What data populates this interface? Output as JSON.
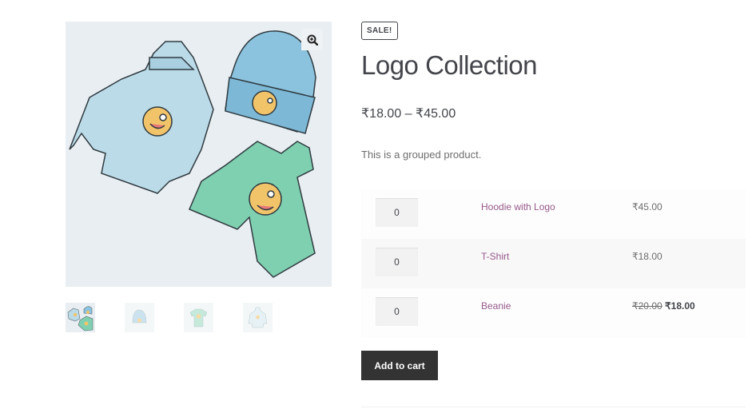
{
  "gallery": {
    "main_image_alt": "Hoodie, beanie and t-shirt with winking emoji logo",
    "zoom_icon": "zoom-in-icon",
    "thumbnails": [
      {
        "alt": "Logo collection (all items)",
        "active": true
      },
      {
        "alt": "Beanie"
      },
      {
        "alt": "T-Shirt"
      },
      {
        "alt": "Hoodie"
      }
    ]
  },
  "product": {
    "sale_badge": "SALE!",
    "title": "Logo Collection",
    "price_range": "₹18.00 – ₹45.00",
    "description": "This is a grouped product."
  },
  "grouped_items": [
    {
      "quantity": "0",
      "name": "Hoodie with Logo",
      "price": "₹45.00"
    },
    {
      "quantity": "0",
      "name": "T-Shirt",
      "price": "₹18.00"
    },
    {
      "quantity": "0",
      "name": "Beanie",
      "regular_price": "₹20.00",
      "sale_price": "₹18.00"
    }
  ],
  "actions": {
    "add_to_cart_label": "Add to cart"
  },
  "colors": {
    "link": "#96588a",
    "button_bg": "#333333",
    "text": "#43454b"
  }
}
